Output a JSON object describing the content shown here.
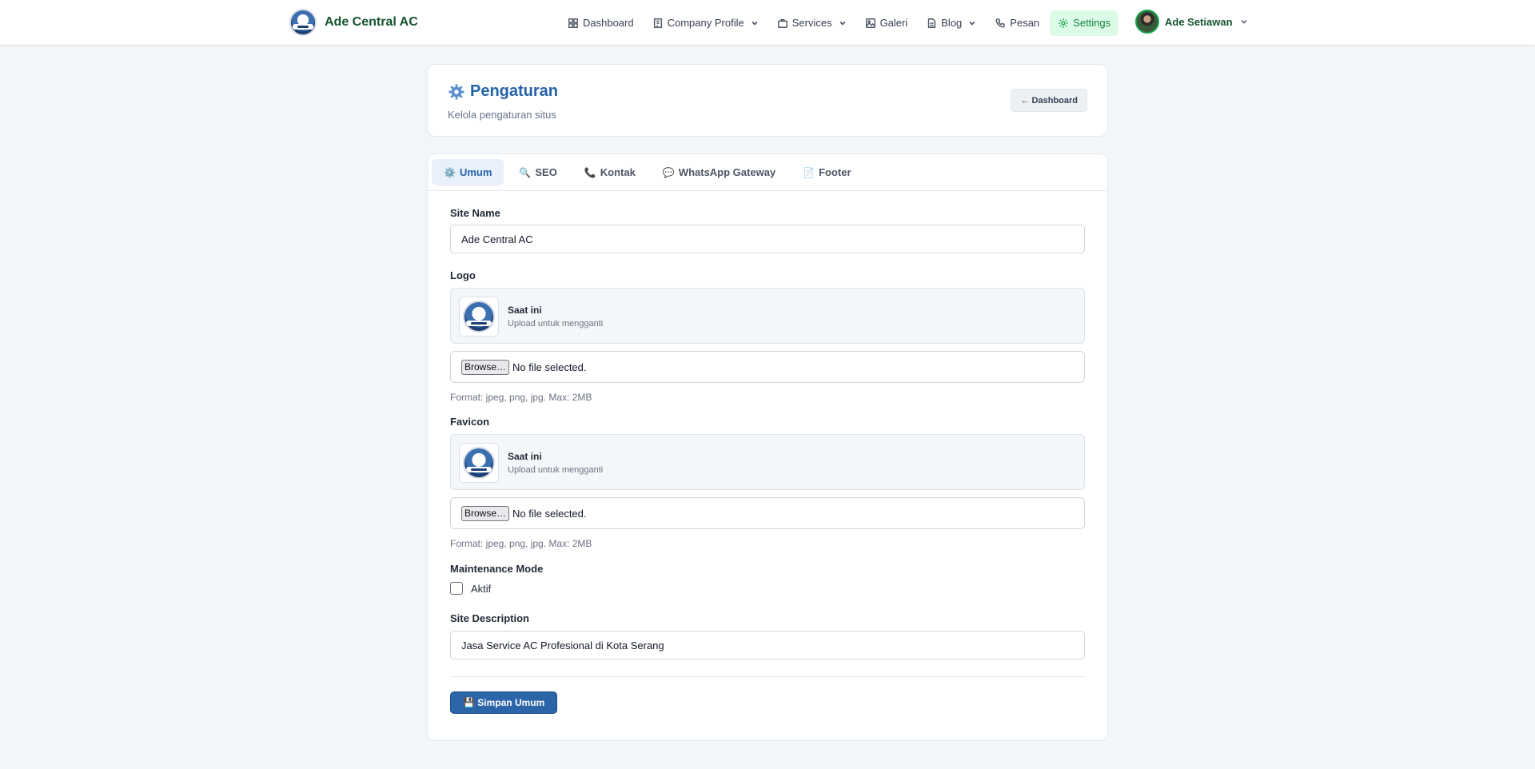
{
  "brand": {
    "name": "Ade Central AC"
  },
  "nav": {
    "items": [
      {
        "label": "Dashboard",
        "icon": "grid-icon"
      },
      {
        "label": "Company Profile",
        "icon": "building-icon",
        "dropdown": true
      },
      {
        "label": "Services",
        "icon": "briefcase-icon",
        "dropdown": true
      },
      {
        "label": "Galeri",
        "icon": "image-icon"
      },
      {
        "label": "Blog",
        "icon": "document-icon",
        "dropdown": true
      },
      {
        "label": "Pesan",
        "icon": "phone-icon"
      },
      {
        "label": "Settings",
        "icon": "settings-icon",
        "active": true
      }
    ]
  },
  "user": {
    "name": "Ade Setiawan"
  },
  "header": {
    "title": "Pengaturan",
    "subtitle": "Kelola pengaturan situs",
    "back_label": "← Dashboard"
  },
  "tabs": [
    {
      "label": "Umum",
      "icon": "⚙️",
      "active": true
    },
    {
      "label": "SEO",
      "icon": "🔍"
    },
    {
      "label": "Kontak",
      "icon": "📞"
    },
    {
      "label": "WhatsApp Gateway",
      "icon": "💬"
    },
    {
      "label": "Footer",
      "icon": "📄"
    }
  ],
  "form": {
    "site_name": {
      "label": "Site Name",
      "value": "Ade Central AC"
    },
    "logo": {
      "label": "Logo",
      "current_title": "Saat ini",
      "current_hint": "Upload untuk mengganti",
      "browse_label": "Browse…",
      "file_status": "No file selected.",
      "format_hint": "Format: jpeg, png, jpg. Max: 2MB"
    },
    "favicon": {
      "label": "Favicon",
      "current_title": "Saat ini",
      "current_hint": "Upload untuk mengganti",
      "browse_label": "Browse…",
      "file_status": "No file selected.",
      "format_hint": "Format: jpeg, png, jpg. Max: 2MB"
    },
    "maintenance": {
      "label": "Maintenance Mode",
      "checkbox_label": "Aktif",
      "checked": false
    },
    "site_description": {
      "label": "Site Description",
      "value": "Jasa Service AC Profesional di Kota Serang"
    },
    "save_label": "💾 Simpan Umum"
  },
  "colors": {
    "accent_blue": "#2563a8",
    "brand_green": "#14532d",
    "active_nav_bg": "#dcfce7",
    "page_bg": "#f3f6f9"
  }
}
